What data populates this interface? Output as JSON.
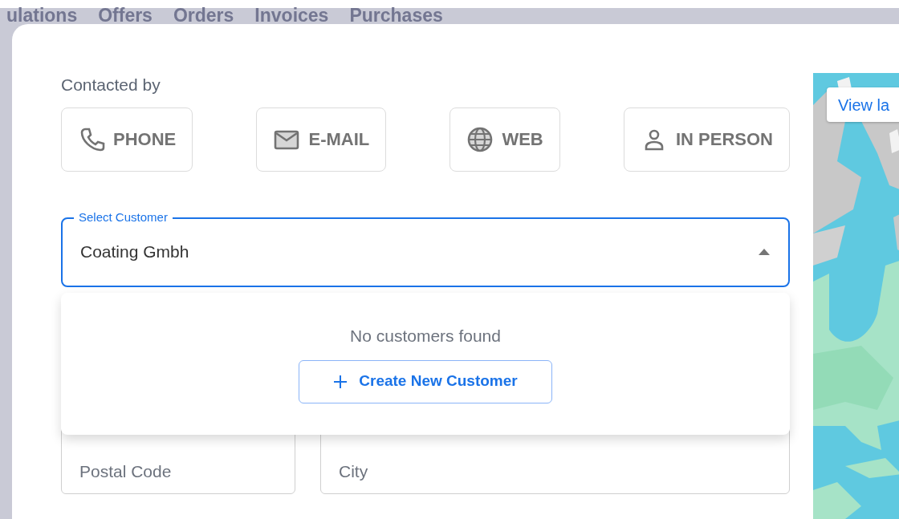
{
  "background_nav": {
    "items": [
      "ulations",
      "Offers",
      "Orders",
      "Invoices",
      "Purchases"
    ]
  },
  "contact": {
    "label": "Contacted by",
    "options": [
      {
        "label": "PHONE",
        "kind": "phone",
        "selected": false
      },
      {
        "label": "E-MAIL",
        "kind": "email",
        "selected": false
      },
      {
        "label": "WEB",
        "kind": "web",
        "selected": false
      },
      {
        "label": "IN PERSON",
        "kind": "person",
        "selected": false
      }
    ]
  },
  "customer_select": {
    "label": "Select Customer",
    "value": "Coating Gmbh",
    "expanded": true
  },
  "dropdown": {
    "message": "No customers found",
    "button": "Create New Customer"
  },
  "address_fields": [
    {
      "placeholder": "Postal Code"
    },
    {
      "placeholder": "City"
    }
  ],
  "map": {
    "button": "View la"
  }
}
